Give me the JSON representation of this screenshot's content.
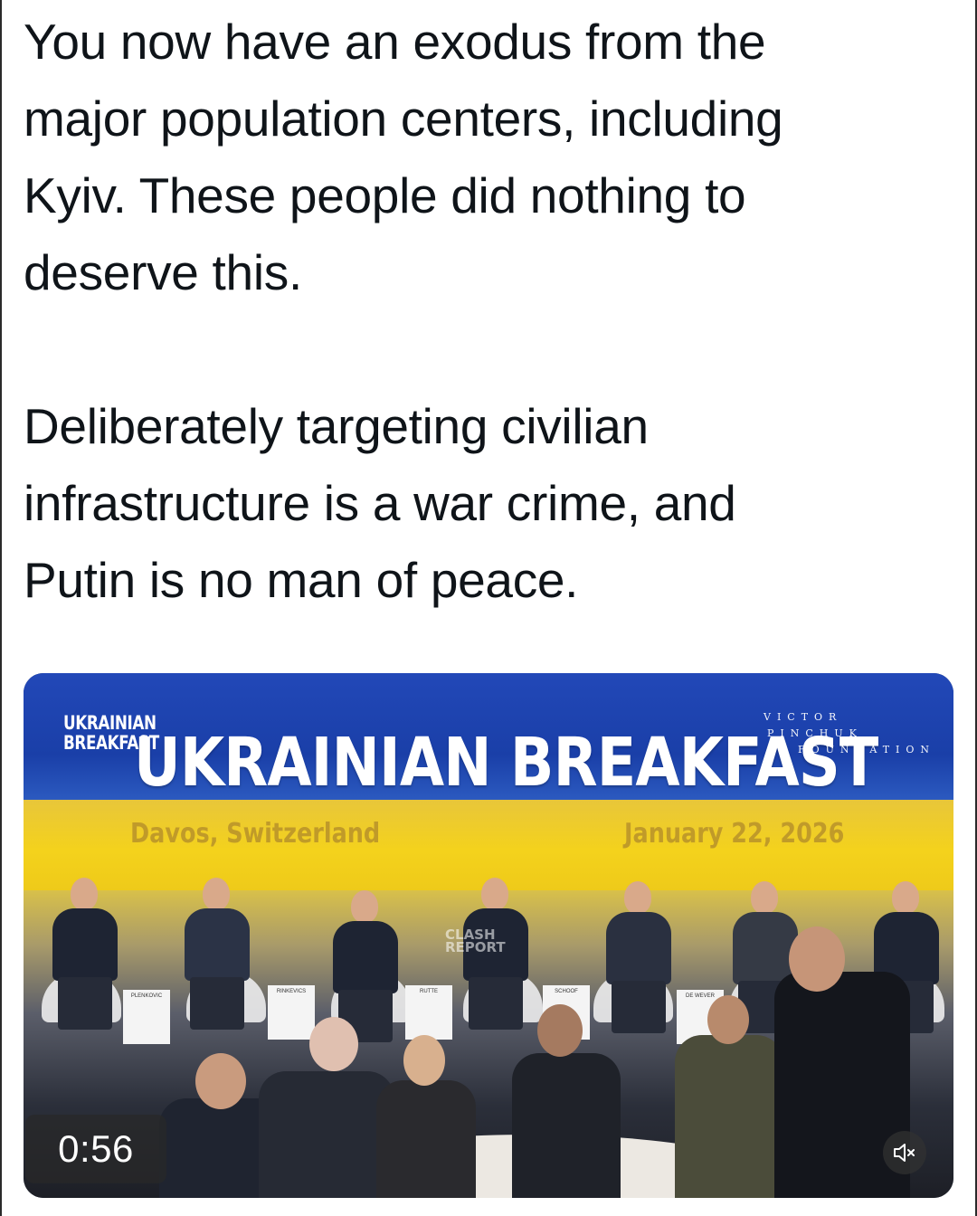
{
  "tweet": {
    "paragraph_1": "You now have an exodus from the\nmajor population centers, including\nKyiv. These people did nothing to\ndeserve this.",
    "paragraph_2": "Deliberately targeting civilian\ninfrastructure is a war crime, and\nPutin is no man of peace."
  },
  "video": {
    "banner_logo_line_1": "UKRAINIAN",
    "banner_logo_line_2": "BREAKFAST",
    "banner_title": "UKRAINIAN BREAKFAST",
    "foundation_line_1": "VICTOR",
    "foundation_line_2": "PINCHUK",
    "foundation_line_3": "FOUNDATION",
    "location": "Davos, Switzerland",
    "date": "January 22, 2026",
    "watermark_line_1": "CLASH",
    "watermark_line_2": "REPORT",
    "name_cards": [
      "PLENKOVIC",
      "RINKEVICS",
      "RUTTE",
      "SCHOOF",
      "DE WEVER"
    ],
    "timer": "0:56",
    "mute_icon": "speaker-muted-icon"
  },
  "colors": {
    "text": "#0f1419",
    "banner_blue": "#1a3fa8",
    "banner_yellow": "#f4d21c",
    "badge_bg": "rgba(40,40,40,0.72)"
  }
}
